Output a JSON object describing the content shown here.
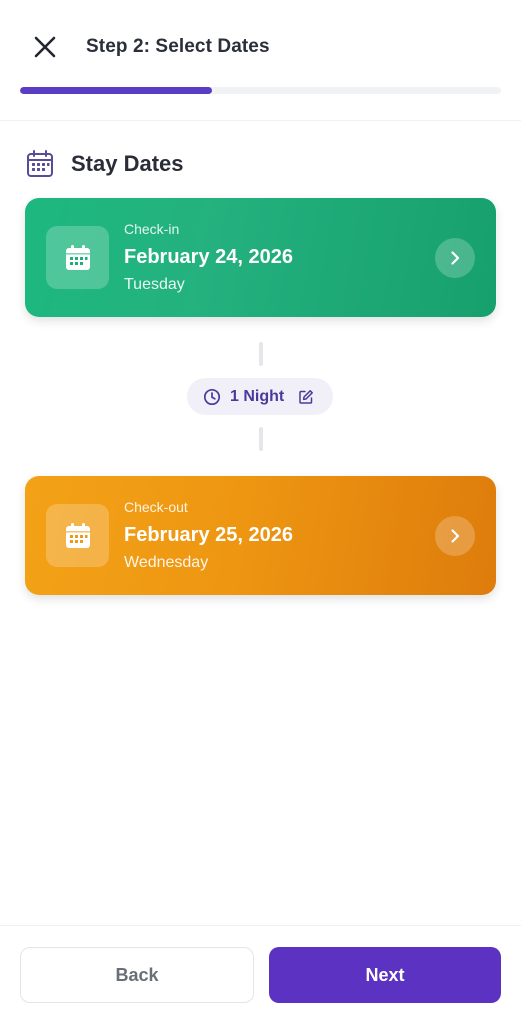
{
  "header": {
    "title": "Step 2: Select Dates",
    "close_icon": "close-icon",
    "progress_fraction": 0.4
  },
  "section": {
    "title": "Stay Dates",
    "icon": "calendar-icon"
  },
  "checkin": {
    "label": "Check-in",
    "date": "February 24, 2026",
    "weekday": "Tuesday",
    "icon": "calendar-icon",
    "arrow_icon": "chevron-right-icon",
    "color": "#1db87f"
  },
  "nights": {
    "label": "1 Night",
    "clock_icon": "clock-icon",
    "edit_icon": "edit-icon"
  },
  "checkout": {
    "label": "Check-out",
    "date": "February 25, 2026",
    "weekday": "Wednesday",
    "icon": "calendar-icon",
    "arrow_icon": "chevron-right-icon",
    "color": "#f3a217"
  },
  "footer": {
    "back_label": "Back",
    "next_label": "Next"
  },
  "colors": {
    "accent": "#5b32c1",
    "progress": "#5b3cc4",
    "pill_text": "#4a3a9a"
  }
}
